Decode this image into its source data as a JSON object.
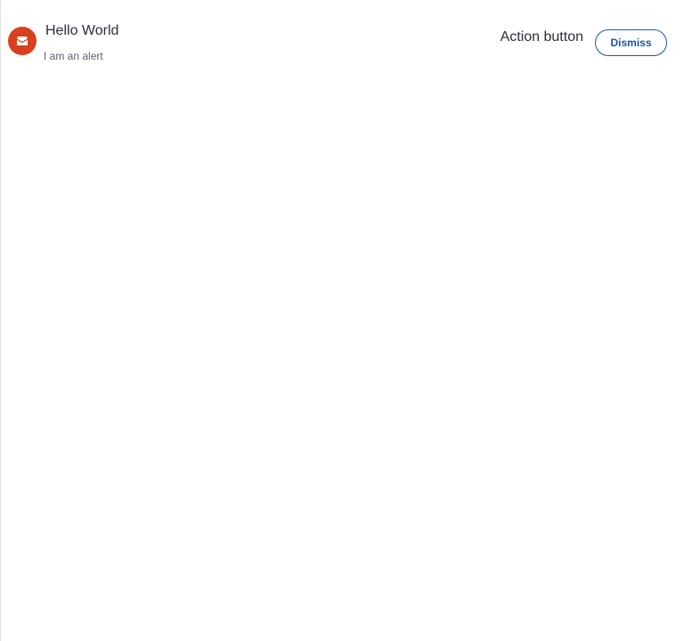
{
  "alert": {
    "title": "Hello World",
    "message": "I am an alert",
    "icon": "envelope-icon",
    "icon_color": "#d8401f",
    "action_label": "Action button",
    "dismiss_label": "Dismiss",
    "dismiss_color": "#1a56a6"
  }
}
